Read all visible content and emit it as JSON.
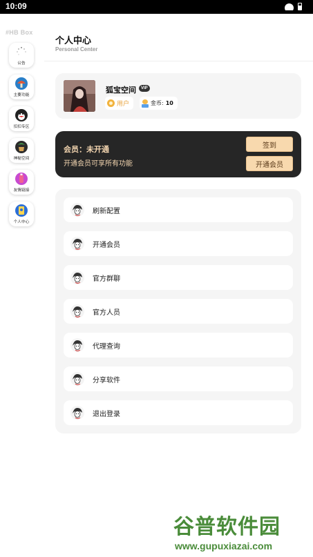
{
  "status_bar": {
    "time": "10:09"
  },
  "sidebar": {
    "brand": "#HB Box",
    "items": [
      {
        "label": "公告",
        "icon": "loading-dots-icon",
        "color": "#ffffff"
      },
      {
        "label": "主要功能",
        "icon": "mushroom-icon",
        "color": "#e05a3a"
      },
      {
        "label": "扣扣专区",
        "icon": "penguin-icon",
        "color": "#222222"
      },
      {
        "label": "神秘空间",
        "icon": "plant-pot-icon",
        "color": "#3b8a44"
      },
      {
        "label": "友情链接",
        "icon": "bottle-icon",
        "color": "#c84ad0"
      },
      {
        "label": "个人中心",
        "icon": "id-card-icon",
        "color": "#2c6fd6"
      }
    ]
  },
  "header": {
    "title": "个人中心",
    "subtitle": "Personal Center"
  },
  "profile": {
    "username": "狐宝空间",
    "vip_badge": "VIP",
    "role": "用户",
    "coin_label": "金币:",
    "coin_value": "10"
  },
  "vip": {
    "status": "会员：未开通",
    "description": "开通会员可享所有功能",
    "sign_in_label": "签到",
    "open_vip_label": "开通会员",
    "accent_color": "#f8d9ae"
  },
  "menu": {
    "items": [
      {
        "label": "刷新配置"
      },
      {
        "label": "开通会员"
      },
      {
        "label": "官方群聊"
      },
      {
        "label": "官方人员"
      },
      {
        "label": "代理查询"
      },
      {
        "label": "分享软件"
      },
      {
        "label": "退出登录"
      }
    ]
  },
  "watermark": {
    "name": "谷普软件园",
    "url": "www.gupuxiazai.com"
  }
}
